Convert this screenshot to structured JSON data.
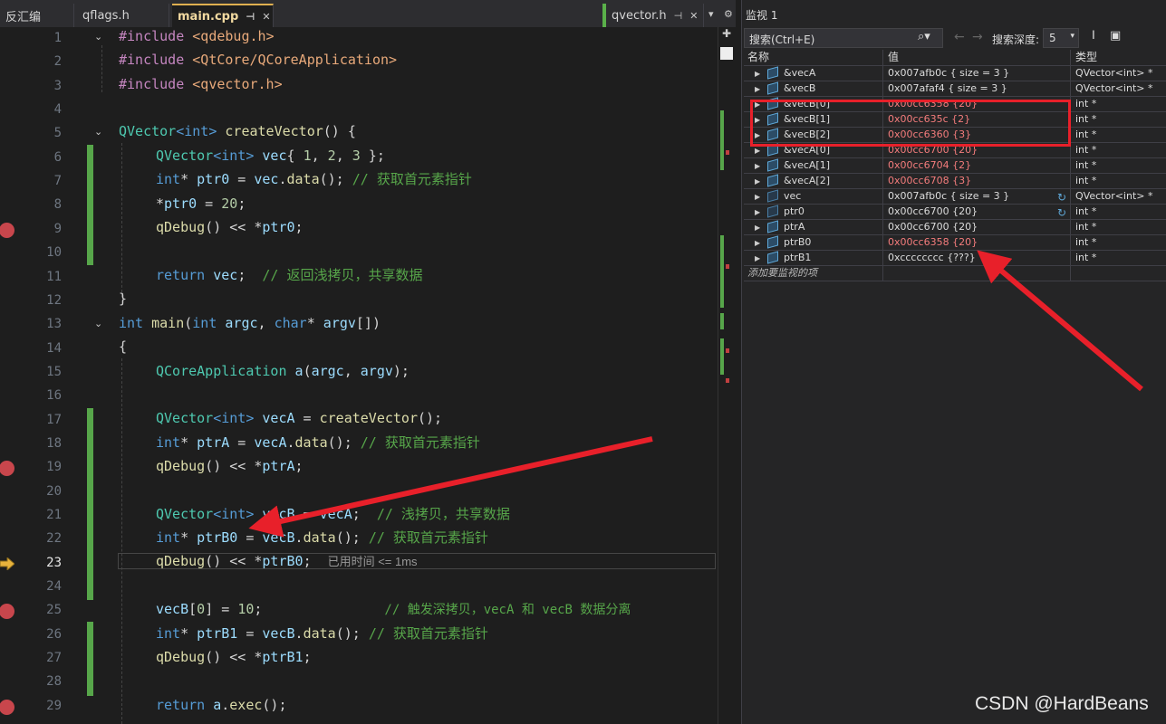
{
  "tabs": {
    "disasm": "反汇编",
    "qflags": "qflags.h",
    "main": "main.cpp",
    "qvector": "qvector.h",
    "pin_glyph": "⊣",
    "close_glyph": "✕"
  },
  "editor": {
    "lines": [
      {
        "n": "1"
      },
      {
        "n": "2"
      },
      {
        "n": "3"
      },
      {
        "n": "4"
      },
      {
        "n": "5"
      },
      {
        "n": "6"
      },
      {
        "n": "7"
      },
      {
        "n": "8"
      },
      {
        "n": "9"
      },
      {
        "n": "10"
      },
      {
        "n": "11"
      },
      {
        "n": "12"
      },
      {
        "n": "13"
      },
      {
        "n": "14"
      },
      {
        "n": "15"
      },
      {
        "n": "16"
      },
      {
        "n": "17"
      },
      {
        "n": "18"
      },
      {
        "n": "19"
      },
      {
        "n": "20"
      },
      {
        "n": "21"
      },
      {
        "n": "22"
      },
      {
        "n": "23"
      },
      {
        "n": "24"
      },
      {
        "n": "25"
      },
      {
        "n": "26"
      },
      {
        "n": "27"
      },
      {
        "n": "28"
      },
      {
        "n": "29"
      }
    ],
    "code": {
      "l1": {
        "a": "#include ",
        "b": "<qdebug.h>"
      },
      "l2": {
        "a": "#include ",
        "b": "<QtCore/QCoreApplication>"
      },
      "l3": {
        "a": "#include ",
        "b": "<qvector.h>"
      },
      "l5": {
        "a": "QVector",
        "b": "<int>",
        "c": " createVector",
        "d": "() {"
      },
      "l6": {
        "a": "QVector",
        "b": "<int>",
        "c": " vec",
        "d": "{ ",
        "e": "1",
        "f": ", ",
        "g": "2",
        "h": ", ",
        "i": "3",
        "j": " };"
      },
      "l7": {
        "a": "int",
        "b": "* ",
        "c": "ptr0",
        "d": " = ",
        "e": "vec",
        "f": ".",
        "g": "data",
        "h": "(); ",
        "i": "// 获取首元素指针"
      },
      "l8": {
        "a": "*",
        "b": "ptr0",
        "c": " = ",
        "d": "20",
        "e": ";"
      },
      "l9": {
        "a": "qDebug",
        "b": "() << *",
        "c": "ptr0",
        "d": ";"
      },
      "l11": {
        "a": "return",
        "b": " vec",
        "c": ";  ",
        "d": "// 返回浅拷贝，共享数据"
      },
      "l12": {
        "a": "}"
      },
      "l13": {
        "a": "int",
        "b": " main",
        "c": "(",
        "d": "int",
        "e": " argc",
        "f": ", ",
        "g": "char",
        "h": "* ",
        "i": "argv",
        "j": "[])"
      },
      "l14": {
        "a": "{"
      },
      "l15": {
        "a": "QCoreApplication",
        "b": " a",
        "c": "(",
        "d": "argc",
        "e": ", ",
        "f": "argv",
        "g": ");"
      },
      "l17": {
        "a": "QVector",
        "b": "<int>",
        "c": " vecA",
        "d": " = ",
        "e": "createVector",
        "f": "();"
      },
      "l18": {
        "a": "int",
        "b": "* ",
        "c": "ptrA",
        "d": " = ",
        "e": "vecA",
        "f": ".",
        "g": "data",
        "h": "(); ",
        "i": "// 获取首元素指针"
      },
      "l19": {
        "a": "qDebug",
        "b": "() << *",
        "c": "ptrA",
        "d": ";"
      },
      "l21": {
        "a": "QVector",
        "b": "<int>",
        "c": " vecB",
        "d": " = ",
        "e": "vecA",
        "f": ";  ",
        "g": "// 浅拷贝，共享数据"
      },
      "l22": {
        "a": "int",
        "b": "* ",
        "c": "ptrB0",
        "d": " = ",
        "e": "vecB",
        "f": ".",
        "g": "data",
        "h": "(); ",
        "i": "// 获取首元素指针"
      },
      "l23": {
        "a": "qDebug",
        "b": "() << *",
        "c": "ptrB0",
        "d": ";",
        "e": "已用时间 <= 1ms"
      },
      "l25": {
        "a": "vecB",
        "b": "[",
        "c": "0",
        "d": "] = ",
        "e": "10",
        "f": ";",
        "g": "// 触发深拷贝，vecA 和 vecB 数据分离"
      },
      "l26": {
        "a": "int",
        "b": "* ",
        "c": "ptrB1",
        "d": " = ",
        "e": "vecB",
        "f": ".",
        "g": "data",
        "h": "(); ",
        "i": "// 获取首元素指针"
      },
      "l27": {
        "a": "qDebug",
        "b": "() << *",
        "c": "ptrB1",
        "d": ";"
      },
      "l29": {
        "a": "return",
        "b": " a",
        "c": ".",
        "d": "exec",
        "e": "();"
      }
    }
  },
  "watch": {
    "title": "监视 1",
    "search_placeholder": "搜索(Ctrl+E)",
    "depth_label": "搜索深度:",
    "depth_value": "5",
    "columns": {
      "name": "名称",
      "value": "值",
      "type": "类型"
    },
    "rows": [
      {
        "name": "&vecA",
        "value": "0x007afb0c { size = 3 }",
        "type": "QVector<int> *",
        "red": false
      },
      {
        "name": "&vecB",
        "value": "0x007afaf4 { size = 3 }",
        "type": "QVector<int> *",
        "red": false
      },
      {
        "name": "&vecB[0]",
        "value": "0x00cc6358 {20}",
        "type": "int *",
        "red": true
      },
      {
        "name": "&vecB[1]",
        "value": "0x00cc635c {2}",
        "type": "int *",
        "red": true
      },
      {
        "name": "&vecB[2]",
        "value": "0x00cc6360 {3}",
        "type": "int *",
        "red": true
      },
      {
        "name": "&vecA[0]",
        "value": "0x00cc6700 {20}",
        "type": "int *",
        "red": true
      },
      {
        "name": "&vecA[1]",
        "value": "0x00cc6704 {2}",
        "type": "int *",
        "red": true
      },
      {
        "name": "&vecA[2]",
        "value": "0x00cc6708 {3}",
        "type": "int *",
        "red": true
      },
      {
        "name": "vec",
        "value": "0x007afb0c { size = 3 }",
        "type": "QVector<int> *",
        "red": false
      },
      {
        "name": "ptr0",
        "value": "0x00cc6700 {20}",
        "type": "int *",
        "red": false
      },
      {
        "name": "ptrA",
        "value": "0x00cc6700 {20}",
        "type": "int *",
        "red": false
      },
      {
        "name": "ptrB0",
        "value": "0x00cc6358 {20}",
        "type": "int *",
        "red": true
      },
      {
        "name": "ptrB1",
        "value": "0xcccccccc {???}",
        "type": "int *",
        "red": false
      }
    ],
    "add_item": "添加要监视的项"
  },
  "watermark": "CSDN @HardBeans",
  "colors": {
    "accent_red": "#e8202a",
    "change_green": "#57a64a",
    "breakpoint": "#c8464c"
  }
}
